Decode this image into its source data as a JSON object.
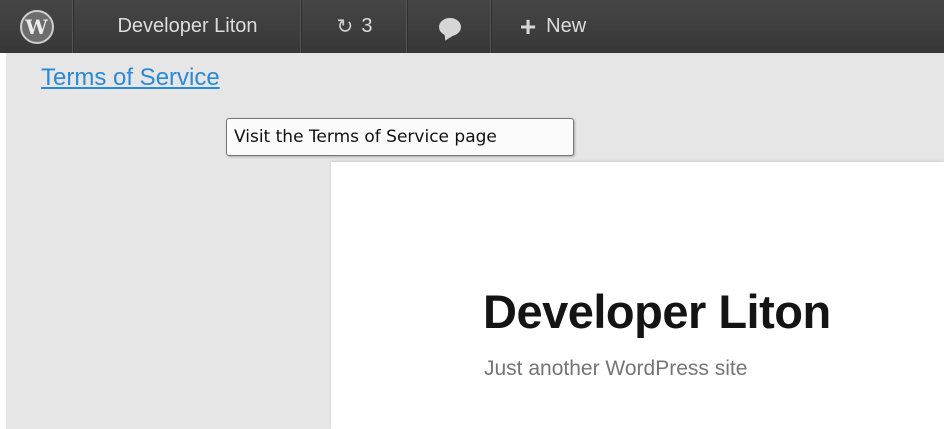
{
  "adminbar": {
    "wp_logo_icon": "wordpress-logo-icon",
    "site_name": "Developer Liton",
    "updates_icon": "refresh-icon",
    "updates_count": "3",
    "comments_icon": "comment-bubble-icon",
    "new_icon": "plus-icon",
    "new_label": "New",
    "bar_color": "#464646"
  },
  "link": {
    "label": "Terms of Service",
    "color": "#2a8ad4"
  },
  "tooltip": {
    "text": "Visit the Terms of Service page"
  },
  "site": {
    "title": "Developer Liton",
    "description": "Just another WordPress site"
  }
}
